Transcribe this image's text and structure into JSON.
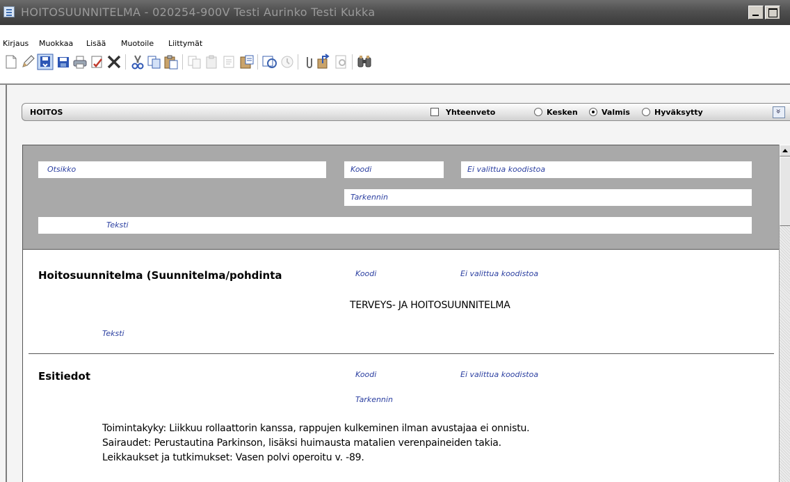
{
  "window": {
    "title": "HOITOSUUNNITELMA - 020254-900V Testi Aurinko Testi Kukka"
  },
  "menu": [
    "Kirjaus",
    "Muokkaa",
    "Lisää",
    "Muotoile",
    "Liittymät"
  ],
  "toolbar": {
    "icons": [
      "new-document-icon",
      "edit-pencil-icon",
      "save-to-record-icon",
      "save-icon",
      "print-icon",
      "sign-icon",
      "delete-icon",
      "cut-icon",
      "copy-icon",
      "paste-icon",
      "copy-template-icon",
      "paste-template-icon",
      "text-template-icon",
      "insert-content-icon",
      "refresh-icon",
      "help-icon",
      "attachment-icon",
      "export-icon",
      "preview-icon",
      "binoculars-icon"
    ]
  },
  "section_header": {
    "title": "HOITOS",
    "summary_label": "Yhteenveto",
    "summary_checked": false,
    "status_options": [
      "Kesken",
      "Valmis",
      "Hyväksytty"
    ],
    "status_selected": "Valmis"
  },
  "header_block": {
    "otsikko_label": "Otsikko",
    "koodi_label": "Koodi",
    "codeset_text": "Ei valittua koodistoa",
    "tarkennin_label": "Tarkennin",
    "teksti_label": "Teksti"
  },
  "sections": [
    {
      "title": "Hoitosuunnitelma (Suunnitelma/pohdinta",
      "koodi_label": "Koodi",
      "codeset_text": "Ei valittua koodistoa",
      "code_value": "TERVEYS- JA HOITOSUUNNITELMA",
      "teksti_label": "Teksti"
    },
    {
      "title": "Esitiedot",
      "koodi_label": "Koodi",
      "codeset_text": "Ei valittua koodistoa",
      "tarkennin_label": "Tarkennin",
      "lines": [
        "Toimintakyky: Liikkuu rollaattorin kanssa, rappujen kulkeminen ilman avustajaa ei onnistu.",
        "Sairaudet: Perustautina Parkinson, lisäksi huimausta matalien verenpaineiden takia.",
        "Leikkaukset ja tutkimukset: Vasen polvi operoitu v. -89."
      ]
    }
  ]
}
